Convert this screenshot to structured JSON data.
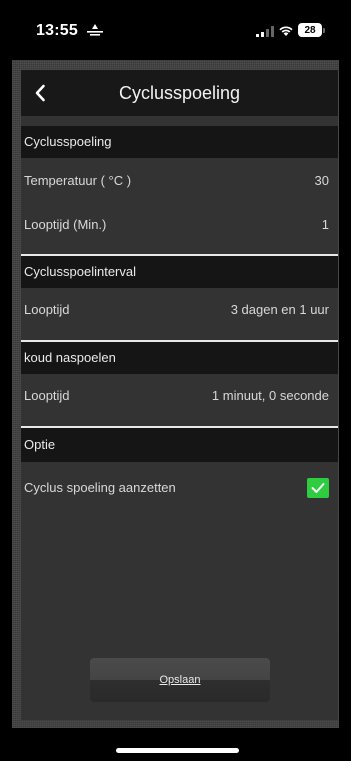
{
  "status_bar": {
    "time": "13:55",
    "battery": "28",
    "icons": [
      "location-icon",
      "signal-icon",
      "wifi-icon",
      "battery-icon"
    ]
  },
  "header": {
    "back_icon": "chevron-left-icon",
    "title": "Cyclusspoeling"
  },
  "sections": {
    "cyclusspoeling": {
      "title": "Cyclusspoeling",
      "temperature_label": "Temperatuur ( °C )",
      "temperature_value": "30",
      "runtime_label": "Looptijd (Min.)",
      "runtime_value": "1"
    },
    "interval": {
      "title": "Cyclusspoelinterval",
      "runtime_label": "Looptijd",
      "runtime_value": "3 dagen en 1 uur"
    },
    "cold_rinse": {
      "title": "koud naspoelen",
      "runtime_label": "Looptijd",
      "runtime_value": "1 minuut, 0 seconde"
    },
    "option": {
      "title": "Optie",
      "enable_label": "Cyclus spoeling aanzetten",
      "enable_checked": true
    }
  },
  "save_label": "Opslaan",
  "colors": {
    "checkbox": "#2ecc40",
    "header_bg": "#181818",
    "content_bg": "#333333"
  }
}
